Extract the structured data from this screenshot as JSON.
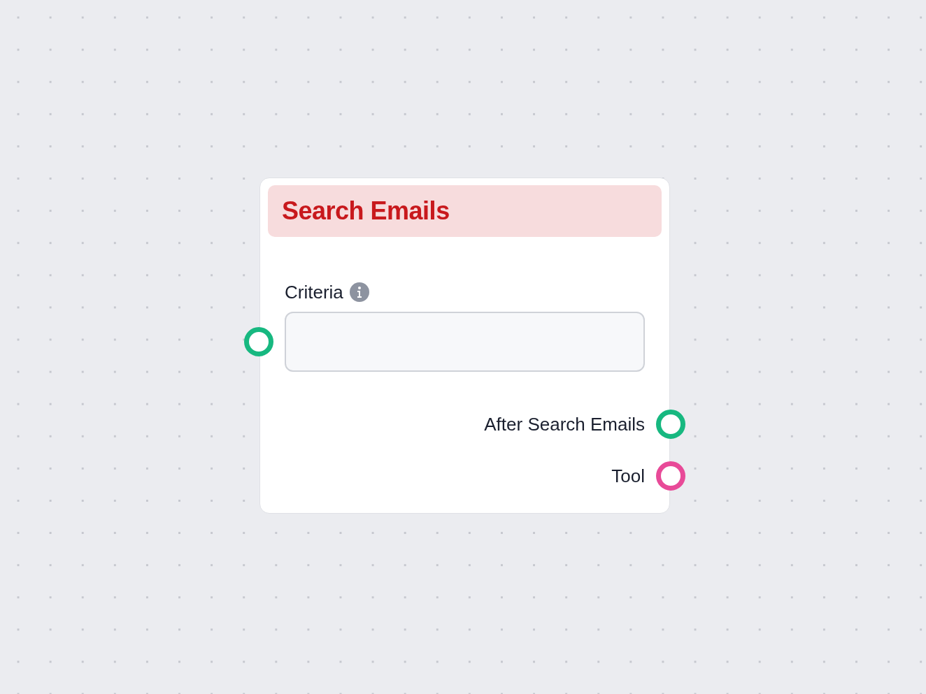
{
  "node": {
    "title": "Search Emails",
    "fields": [
      {
        "label": "Criteria",
        "info": true,
        "color": "#17b880"
      }
    ],
    "outputs": [
      {
        "label": "After Search Emails",
        "color": "#17b880"
      },
      {
        "label": "Tool",
        "color": "#e84a98"
      }
    ]
  }
}
